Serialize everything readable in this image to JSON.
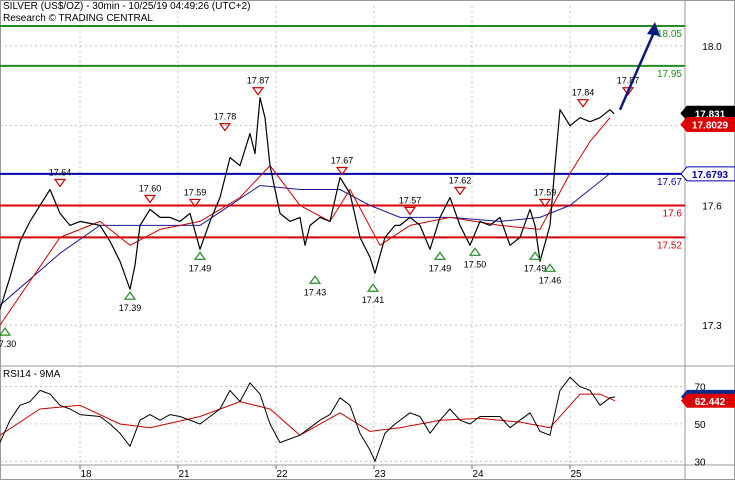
{
  "header": {
    "title": "SILVER (US$/OZ) - 30min - 10/25/19 04:49:26 (UTC+2)",
    "subtitle": "Research © TRADING CENTRAL"
  },
  "rsi_panel": {
    "label": "RSI14 - 9MA"
  },
  "colors": {
    "background": "#ffffff",
    "price_line": "#000000",
    "moving_average_short": "#cc0000",
    "moving_average_long": "#1a1a99",
    "resistance_green": "#228B22",
    "pivot_blue": "#0000aa",
    "support_red": "#dd0000",
    "arrow": "#0a1a7a",
    "down_marker": "#cc0000",
    "up_marker": "#228B22",
    "grid": "#aaaaaa",
    "current_price_box": "#000000",
    "ma_price_box": "#dd0000",
    "rsi_box": "#0a2a8a"
  },
  "chart_data": [
    {
      "type": "line",
      "panel": "price",
      "ylim": [
        17.2,
        18.1
      ],
      "y_ticks": [
        18.0,
        17.8,
        17.6,
        17.3
      ],
      "x_ticks": [
        "18",
        "21",
        "22",
        "23",
        "24",
        "25"
      ],
      "grid": true,
      "series": [
        {
          "role": "price",
          "points": [
            [
              0.0,
              17.34
            ],
            [
              0.1,
              17.42
            ],
            [
              0.2,
              17.51
            ],
            [
              0.3,
              17.56
            ],
            [
              0.4,
              17.6
            ],
            [
              0.5,
              17.64
            ],
            [
              0.6,
              17.58
            ],
            [
              0.7,
              17.55
            ],
            [
              0.8,
              17.56
            ],
            [
              1.0,
              17.55
            ],
            [
              1.1,
              17.51
            ],
            [
              1.2,
              17.46
            ],
            [
              1.3,
              17.39
            ],
            [
              1.35,
              17.45
            ],
            [
              1.4,
              17.55
            ],
            [
              1.5,
              17.59
            ],
            [
              1.6,
              17.57
            ],
            [
              1.7,
              17.57
            ],
            [
              1.8,
              17.56
            ],
            [
              1.9,
              17.58
            ],
            [
              2.0,
              17.49
            ],
            [
              2.1,
              17.56
            ],
            [
              2.2,
              17.62
            ],
            [
              2.3,
              17.72
            ],
            [
              2.4,
              17.7
            ],
            [
              2.5,
              17.78
            ],
            [
              2.55,
              17.73
            ],
            [
              2.6,
              17.87
            ],
            [
              2.65,
              17.82
            ],
            [
              2.7,
              17.7
            ],
            [
              2.8,
              17.58
            ],
            [
              2.9,
              17.56
            ],
            [
              3.0,
              17.57
            ],
            [
              3.05,
              17.5
            ],
            [
              3.1,
              17.55
            ],
            [
              3.2,
              17.57
            ],
            [
              3.3,
              17.56
            ],
            [
              3.4,
              17.67
            ],
            [
              3.5,
              17.63
            ],
            [
              3.6,
              17.52
            ],
            [
              3.7,
              17.47
            ],
            [
              3.75,
              17.43
            ],
            [
              3.85,
              17.52
            ],
            [
              3.95,
              17.55
            ],
            [
              4.0,
              17.55
            ],
            [
              4.1,
              17.57
            ],
            [
              4.2,
              17.55
            ],
            [
              4.3,
              17.49
            ],
            [
              4.4,
              17.57
            ],
            [
              4.5,
              17.62
            ],
            [
              4.6,
              17.55
            ],
            [
              4.7,
              17.5
            ],
            [
              4.8,
              17.56
            ],
            [
              4.9,
              17.55
            ],
            [
              5.0,
              17.57
            ],
            [
              5.1,
              17.5
            ],
            [
              5.2,
              17.52
            ],
            [
              5.3,
              17.59
            ],
            [
              5.35,
              17.55
            ],
            [
              5.4,
              17.46
            ],
            [
              5.5,
              17.55
            ],
            [
              5.55,
              17.7
            ],
            [
              5.6,
              17.84
            ],
            [
              5.7,
              17.8
            ],
            [
              5.8,
              17.82
            ],
            [
              5.9,
              17.81
            ],
            [
              6.0,
              17.82
            ],
            [
              6.1,
              17.84
            ],
            [
              6.14,
              17.83
            ]
          ]
        },
        {
          "role": "moving-average-short",
          "points": [
            [
              0.0,
              17.3
            ],
            [
              0.6,
              17.52
            ],
            [
              1.0,
              17.56
            ],
            [
              1.3,
              17.5
            ],
            [
              1.6,
              17.54
            ],
            [
              2.0,
              17.56
            ],
            [
              2.4,
              17.62
            ],
            [
              2.7,
              17.7
            ],
            [
              3.0,
              17.6
            ],
            [
              3.3,
              17.56
            ],
            [
              3.5,
              17.64
            ],
            [
              3.8,
              17.5
            ],
            [
              4.1,
              17.55
            ],
            [
              4.5,
              17.57
            ],
            [
              5.0,
              17.55
            ],
            [
              5.4,
              17.54
            ],
            [
              5.7,
              17.68
            ],
            [
              5.9,
              17.76
            ],
            [
              6.1,
              17.82
            ]
          ]
        },
        {
          "role": "moving-average-long",
          "points": [
            [
              0.0,
              17.35
            ],
            [
              0.6,
              17.48
            ],
            [
              1.0,
              17.55
            ],
            [
              1.5,
              17.55
            ],
            [
              2.0,
              17.55
            ],
            [
              2.3,
              17.6
            ],
            [
              2.6,
              17.65
            ],
            [
              3.0,
              17.64
            ],
            [
              3.4,
              17.64
            ],
            [
              3.7,
              17.6
            ],
            [
              4.0,
              17.57
            ],
            [
              4.5,
              17.57
            ],
            [
              5.0,
              17.56
            ],
            [
              5.4,
              17.57
            ],
            [
              5.7,
              17.6
            ],
            [
              6.1,
              17.68
            ]
          ]
        }
      ],
      "levels": [
        {
          "value": 18.05,
          "label": "18.05",
          "kind": "resistance"
        },
        {
          "value": 17.95,
          "label": "17.95",
          "kind": "resistance"
        },
        {
          "value": 17.6793,
          "label": "17.67",
          "kind": "pivot"
        },
        {
          "value": 17.6,
          "label": "17.6",
          "kind": "support"
        },
        {
          "value": 17.52,
          "label": "17.52",
          "kind": "support"
        }
      ],
      "annotations": [
        {
          "x": 0.05,
          "value": 17.3,
          "label": "17.30",
          "type": "low"
        },
        {
          "x": 0.6,
          "value": 17.64,
          "label": "17.64",
          "type": "high"
        },
        {
          "x": 1.3,
          "value": 17.39,
          "label": "17.39",
          "type": "low"
        },
        {
          "x": 1.5,
          "value": 17.6,
          "label": "17.60",
          "type": "high"
        },
        {
          "x": 2.0,
          "value": 17.49,
          "label": "17.49",
          "type": "low"
        },
        {
          "x": 1.95,
          "value": 17.59,
          "label": "17.59",
          "type": "high"
        },
        {
          "x": 2.25,
          "value": 17.78,
          "label": "17.78",
          "type": "high"
        },
        {
          "x": 2.58,
          "value": 17.87,
          "label": "17.87",
          "type": "high"
        },
        {
          "x": 3.15,
          "value": 17.43,
          "label": "17.43",
          "type": "low"
        },
        {
          "x": 3.42,
          "value": 17.67,
          "label": "17.67",
          "type": "high"
        },
        {
          "x": 3.73,
          "value": 17.41,
          "label": "17.41",
          "type": "low"
        },
        {
          "x": 4.1,
          "value": 17.57,
          "label": "17.57",
          "type": "high"
        },
        {
          "x": 4.4,
          "value": 17.49,
          "label": "17.49",
          "type": "low"
        },
        {
          "x": 4.6,
          "value": 17.62,
          "label": "17.62",
          "type": "high"
        },
        {
          "x": 4.75,
          "value": 17.5,
          "label": "17.50",
          "type": "low"
        },
        {
          "x": 5.35,
          "value": 17.49,
          "label": "17.49",
          "type": "low"
        },
        {
          "x": 5.45,
          "value": 17.59,
          "label": "17.59",
          "type": "high"
        },
        {
          "x": 5.5,
          "value": 17.46,
          "label": "17.46",
          "type": "low"
        },
        {
          "x": 5.83,
          "value": 17.84,
          "label": "17.84",
          "type": "high"
        },
        {
          "x": 6.28,
          "value": 17.87,
          "label": "17.87",
          "type": "high"
        }
      ],
      "projection_arrow": {
        "from": [
          6.2,
          17.84
        ],
        "to": [
          6.55,
          18.06
        ]
      },
      "value_tags": [
        {
          "value": 17.831,
          "label": "17.831",
          "style": "current"
        },
        {
          "value": 17.8029,
          "label": "17.8029",
          "style": "ma"
        },
        {
          "value": 17.6793,
          "label": "17.6793",
          "style": "pivot"
        }
      ]
    },
    {
      "type": "line",
      "panel": "rsi",
      "ylim": [
        28,
        80
      ],
      "y_ticks": [
        70,
        50,
        30
      ],
      "series": [
        {
          "role": "rsi",
          "points": [
            [
              0.0,
              40
            ],
            [
              0.1,
              52
            ],
            [
              0.2,
              60
            ],
            [
              0.3,
              62
            ],
            [
              0.4,
              68
            ],
            [
              0.5,
              66
            ],
            [
              0.6,
              60
            ],
            [
              0.7,
              58
            ],
            [
              0.8,
              55
            ],
            [
              1.0,
              54
            ],
            [
              1.1,
              50
            ],
            [
              1.2,
              45
            ],
            [
              1.3,
              38
            ],
            [
              1.4,
              52
            ],
            [
              1.5,
              55
            ],
            [
              1.6,
              52
            ],
            [
              1.7,
              55
            ],
            [
              1.8,
              54
            ],
            [
              1.9,
              52
            ],
            [
              2.0,
              50
            ],
            [
              2.2,
              58
            ],
            [
              2.3,
              68
            ],
            [
              2.4,
              62
            ],
            [
              2.5,
              72
            ],
            [
              2.6,
              66
            ],
            [
              2.7,
              50
            ],
            [
              2.8,
              40
            ],
            [
              2.9,
              42
            ],
            [
              3.0,
              44
            ],
            [
              3.1,
              48
            ],
            [
              3.2,
              52
            ],
            [
              3.3,
              55
            ],
            [
              3.4,
              64
            ],
            [
              3.5,
              60
            ],
            [
              3.6,
              45
            ],
            [
              3.7,
              36
            ],
            [
              3.75,
              30
            ],
            [
              3.85,
              45
            ],
            [
              3.95,
              50
            ],
            [
              4.1,
              56
            ],
            [
              4.2,
              54
            ],
            [
              4.3,
              45
            ],
            [
              4.4,
              52
            ],
            [
              4.5,
              58
            ],
            [
              4.6,
              52
            ],
            [
              4.7,
              50
            ],
            [
              4.8,
              54
            ],
            [
              5.0,
              54
            ],
            [
              5.1,
              48
            ],
            [
              5.2,
              52
            ],
            [
              5.3,
              56
            ],
            [
              5.4,
              46
            ],
            [
              5.5,
              44
            ],
            [
              5.6,
              68
            ],
            [
              5.7,
              75
            ],
            [
              5.8,
              70
            ],
            [
              5.9,
              68
            ],
            [
              6.0,
              60
            ],
            [
              6.1,
              64
            ],
            [
              6.15,
              64.5
            ]
          ]
        },
        {
          "role": "rsi-ma",
          "points": [
            [
              0.0,
              44
            ],
            [
              0.4,
              58
            ],
            [
              0.8,
              60
            ],
            [
              1.2,
              50
            ],
            [
              1.5,
              48
            ],
            [
              2.0,
              54
            ],
            [
              2.4,
              62
            ],
            [
              2.7,
              58
            ],
            [
              3.0,
              44
            ],
            [
              3.4,
              56
            ],
            [
              3.7,
              46
            ],
            [
              4.0,
              48
            ],
            [
              4.4,
              52
            ],
            [
              4.8,
              53
            ],
            [
              5.2,
              51
            ],
            [
              5.5,
              48
            ],
            [
              5.8,
              66
            ],
            [
              6.0,
              66
            ],
            [
              6.15,
              62.4
            ]
          ]
        }
      ],
      "value_tags": [
        {
          "value": 64.5165,
          "label": "64.5165",
          "style": "rsi"
        },
        {
          "value": 62.442,
          "label": "62.442",
          "style": "rsi-ma"
        }
      ]
    }
  ]
}
